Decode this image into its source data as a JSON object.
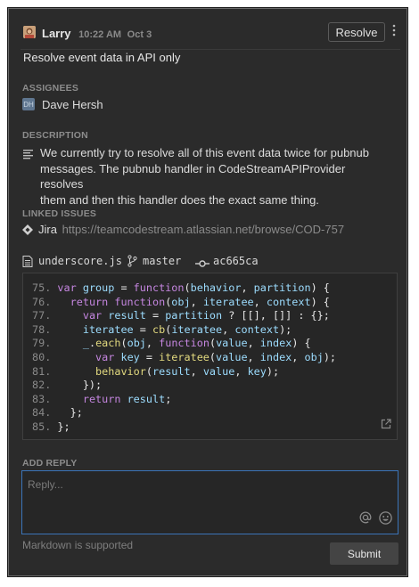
{
  "comment": {
    "author": "Larry",
    "time": "10:22 AM",
    "date": "Oct 3",
    "resolve_label": "Resolve",
    "title": "Resolve event data in API only"
  },
  "assignees": {
    "label": "ASSIGNEES",
    "initials": "DH",
    "name": "Dave Hersh"
  },
  "description": {
    "label": "DESCRIPTION",
    "lines": [
      "We currently try to resolve all of this event data twice for pubnub",
      "messages. The pubnub handler in CodeStreamAPIProvider resolves",
      "them and then this handler does the exact same thing."
    ]
  },
  "linked_issues": {
    "label": "LINKED ISSUES",
    "provider": "Jira",
    "url": "https://teamcodestream.atlassian.net/browse/COD-757"
  },
  "code_ref": {
    "file": "underscore.js",
    "branch": "master",
    "commit": "ac665ca"
  },
  "code_lines": [
    {
      "n": "75.",
      "parts": [
        [
          "kw",
          "var "
        ],
        [
          "id",
          "group"
        ],
        [
          "pl",
          " = "
        ],
        [
          "kw",
          "function"
        ],
        [
          "pl",
          "("
        ],
        [
          "id",
          "behavior"
        ],
        [
          "pl",
          ", "
        ],
        [
          "id",
          "partition"
        ],
        [
          "pl",
          ") {"
        ]
      ]
    },
    {
      "n": "76.",
      "parts": [
        [
          "pl",
          "  "
        ],
        [
          "kw",
          "return function"
        ],
        [
          "pl",
          "("
        ],
        [
          "id",
          "obj"
        ],
        [
          "pl",
          ", "
        ],
        [
          "id",
          "iteratee"
        ],
        [
          "pl",
          ", "
        ],
        [
          "id",
          "context"
        ],
        [
          "pl",
          ") {"
        ]
      ]
    },
    {
      "n": "77.",
      "parts": [
        [
          "pl",
          "    "
        ],
        [
          "kw",
          "var "
        ],
        [
          "id",
          "result"
        ],
        [
          "pl",
          " = "
        ],
        [
          "id",
          "partition"
        ],
        [
          "pl",
          " ? [[], []] : {};"
        ]
      ]
    },
    {
      "n": "78.",
      "parts": [
        [
          "pl",
          "    "
        ],
        [
          "id",
          "iteratee"
        ],
        [
          "pl",
          " = "
        ],
        [
          "fn",
          "cb"
        ],
        [
          "pl",
          "("
        ],
        [
          "id",
          "iteratee"
        ],
        [
          "pl",
          ", "
        ],
        [
          "id",
          "context"
        ],
        [
          "pl",
          ");"
        ]
      ]
    },
    {
      "n": "79.",
      "parts": [
        [
          "pl",
          "    "
        ],
        [
          "id",
          "_"
        ],
        [
          "pl",
          "."
        ],
        [
          "fn",
          "each"
        ],
        [
          "pl",
          "("
        ],
        [
          "id",
          "obj"
        ],
        [
          "pl",
          ", "
        ],
        [
          "kw",
          "function"
        ],
        [
          "pl",
          "("
        ],
        [
          "id",
          "value"
        ],
        [
          "pl",
          ", "
        ],
        [
          "id",
          "index"
        ],
        [
          "pl",
          ") {"
        ]
      ]
    },
    {
      "n": "80.",
      "parts": [
        [
          "pl",
          "      "
        ],
        [
          "kw",
          "var "
        ],
        [
          "id",
          "key"
        ],
        [
          "pl",
          " = "
        ],
        [
          "fn",
          "iteratee"
        ],
        [
          "pl",
          "("
        ],
        [
          "id",
          "value"
        ],
        [
          "pl",
          ", "
        ],
        [
          "id",
          "index"
        ],
        [
          "pl",
          ", "
        ],
        [
          "id",
          "obj"
        ],
        [
          "pl",
          ");"
        ]
      ]
    },
    {
      "n": "81.",
      "parts": [
        [
          "pl",
          "      "
        ],
        [
          "fn",
          "behavior"
        ],
        [
          "pl",
          "("
        ],
        [
          "id",
          "result"
        ],
        [
          "pl",
          ", "
        ],
        [
          "id",
          "value"
        ],
        [
          "pl",
          ", "
        ],
        [
          "id",
          "key"
        ],
        [
          "pl",
          ");"
        ]
      ]
    },
    {
      "n": "82.",
      "parts": [
        [
          "pl",
          "    });"
        ]
      ]
    },
    {
      "n": "83.",
      "parts": [
        [
          "pl",
          "    "
        ],
        [
          "kw",
          "return "
        ],
        [
          "id",
          "result"
        ],
        [
          "pl",
          ";"
        ]
      ]
    },
    {
      "n": "84.",
      "parts": [
        [
          "pl",
          "  };"
        ]
      ]
    },
    {
      "n": "85.",
      "parts": [
        [
          "pl",
          "};"
        ]
      ]
    }
  ],
  "reply": {
    "label": "ADD REPLY",
    "placeholder": "Reply...",
    "hint": "Markdown is supported",
    "submit_label": "Submit"
  },
  "icons": [
    "avatar-icon",
    "kebab-menu-icon",
    "description-icon",
    "jira-icon",
    "file-icon",
    "branch-icon",
    "commit-icon",
    "open-external-icon",
    "mention-icon",
    "emoji-icon"
  ]
}
